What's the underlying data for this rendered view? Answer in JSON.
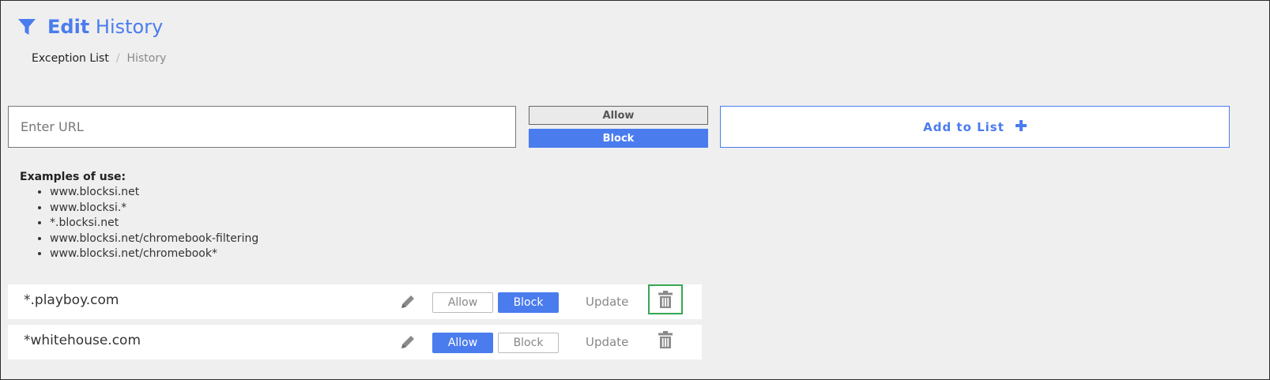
{
  "header": {
    "title_bold": "Edit",
    "title_rest": "History",
    "icon": "filter-icon",
    "accent_color": "#4a7cee"
  },
  "breadcrumb": {
    "items": [
      "Exception List",
      "History"
    ],
    "separator": "/"
  },
  "form": {
    "url_placeholder": "Enter URL",
    "url_value": "",
    "allow_label": "Allow",
    "block_label": "Block",
    "selected_option": "Block",
    "add_label": "Add to List",
    "add_icon": "plus-icon"
  },
  "examples": {
    "title": "Examples of use:",
    "items": [
      "www.blocksi.net",
      "www.blocksi.*",
      "*.blocksi.net",
      "www.blocksi.net/chromebook-filtering",
      "www.blocksi.net/chromebook*"
    ]
  },
  "entries": [
    {
      "url": "*.playboy.com",
      "allow_label": "Allow",
      "block_label": "Block",
      "selected": "Block",
      "update_label": "Update",
      "edit_icon": "pencil-icon",
      "delete_icon": "trash-icon"
    },
    {
      "url": "*whitehouse.com",
      "allow_label": "Allow",
      "block_label": "Block",
      "selected": "Allow",
      "update_label": "Update",
      "edit_icon": "pencil-icon",
      "delete_icon": "trash-icon"
    }
  ],
  "colors": {
    "accent": "#4a7cee",
    "background": "#efefef",
    "focus_outline": "#36a853"
  }
}
